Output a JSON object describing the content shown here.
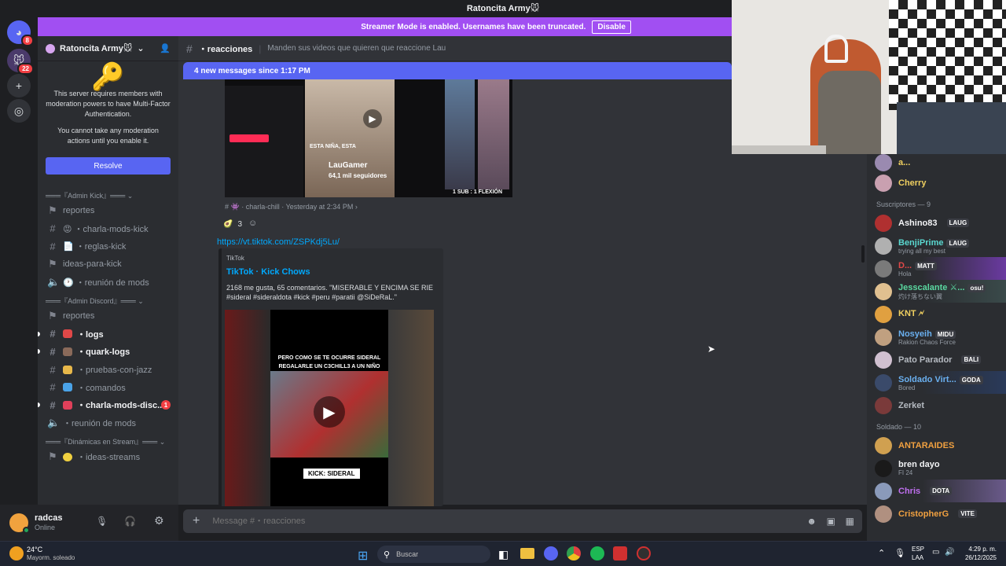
{
  "window": {
    "title": "Ratoncita Army🐭"
  },
  "rail": {
    "badge1": "8",
    "badge2": "22"
  },
  "banner": {
    "text": "Streamer Mode is enabled. Usernames have been truncated.",
    "button": "Disable"
  },
  "server": {
    "name": "Ratoncita Army🐭",
    "mfa_line1": "This server requires members with moderation powers to have Multi-Factor Authentication.",
    "mfa_line2": "You cannot take any moderation actions until you enable it.",
    "resolve": "Resolve"
  },
  "channels": {
    "cat1": "═══『Admin Kick』═══ ⌄",
    "c1": "reportes",
    "c2": "😡 ・charla-mods-kick",
    "c3": "📄 ・reglas-kick",
    "c4": "ideas-para-kick",
    "c5": "🕐 ・reunión de mods",
    "cat2": "═══『Admin Discord』═══ ⌄",
    "c6": "reportes",
    "c7": "・logs",
    "c8": "・quark-logs",
    "c9": "・pruebas-con-jazz",
    "c10": "・comandos",
    "c11": "・charla-mods-disc...",
    "c11_badge": "1",
    "c12": "・reunión de mods",
    "cat3": "═══『Dinámicas en Stream』═══ ⌄",
    "c13": "・ideas-streams"
  },
  "user": {
    "name": "radcas",
    "status": "Online"
  },
  "chat": {
    "channel_name": "・reacciones",
    "topic": "Manden sus videos que quieren que reaccione Lau",
    "new_messages": "4 new messages since 1:17 PM",
    "forward_channel": "charla-chill",
    "forward_time": "Yesterday at 2:34 PM",
    "reaction_count": "3",
    "link": "https://vt.tiktok.com/ZSPKdj5Lu/",
    "embed_provider": "TikTok",
    "embed_title": "TikTok · Kick Chows",
    "embed_desc": "2168 me gusta, 65 comentarios. \"MISERABLE Y ENCIMA SE RIE #sideral #sideraldota #kick #peru #paratii @SiDeRaL.\"",
    "video_caption": "PERO COMO SE TE OCURRE SIDERAL REGALARLE UN C3CHILL3 A UN NIÑO",
    "video_label": "KICK: SIDERAL",
    "thumb_name": "LauGamer",
    "thumb_followers": "64,1 mil seguidores",
    "thumb_caption": "ESTA NIÑA, ESTA",
    "thumb_corner": "1 SUB : 1 FLEXIÓN",
    "placeholder": "Message #・reacciones"
  },
  "members": {
    "top1": "a...",
    "top2": "Cherry",
    "section1": "Suscriptores — 9",
    "m1": "Ashino83",
    "m1_tag": "LAUG",
    "m2": "BenjiPrime",
    "m2_tag": "LAUG",
    "m2_sub": "trying all my best",
    "m3": "D...",
    "m3_tag": "MATT",
    "m3_sub": "Hola",
    "m4": "Jesscalante ⚔...",
    "m4_tag": "osu!",
    "m4_sub": "灼け落ちない翼",
    "m5": "KNT 🗲",
    "m5_tag": "",
    "m6": "Nosyeih",
    "m6_tag": "MIDU",
    "m6_sub": "Rakion Chaos Force",
    "m7": "Pato Parador",
    "m7_tag": "BALI",
    "m8": "Soldado Virt...",
    "m8_tag": "GODA",
    "m8_sub": "Bored",
    "m9": "Zerket",
    "section2": "Soldado — 10",
    "s1": "ANTARAIDES",
    "s2": "bren dayo",
    "s2_sub": "FI 24",
    "s3": "Chris",
    "s3_tag": "DOTA",
    "s4": "CristopherG",
    "s4_tag": "VITE"
  },
  "taskbar": {
    "temp": "24°C",
    "weather": "Mayorm. soleado",
    "search": "Buscar",
    "lang1": "ESP",
    "lang2": "LAA",
    "time": "4:29 p. m.",
    "date": "26/12/2025"
  }
}
